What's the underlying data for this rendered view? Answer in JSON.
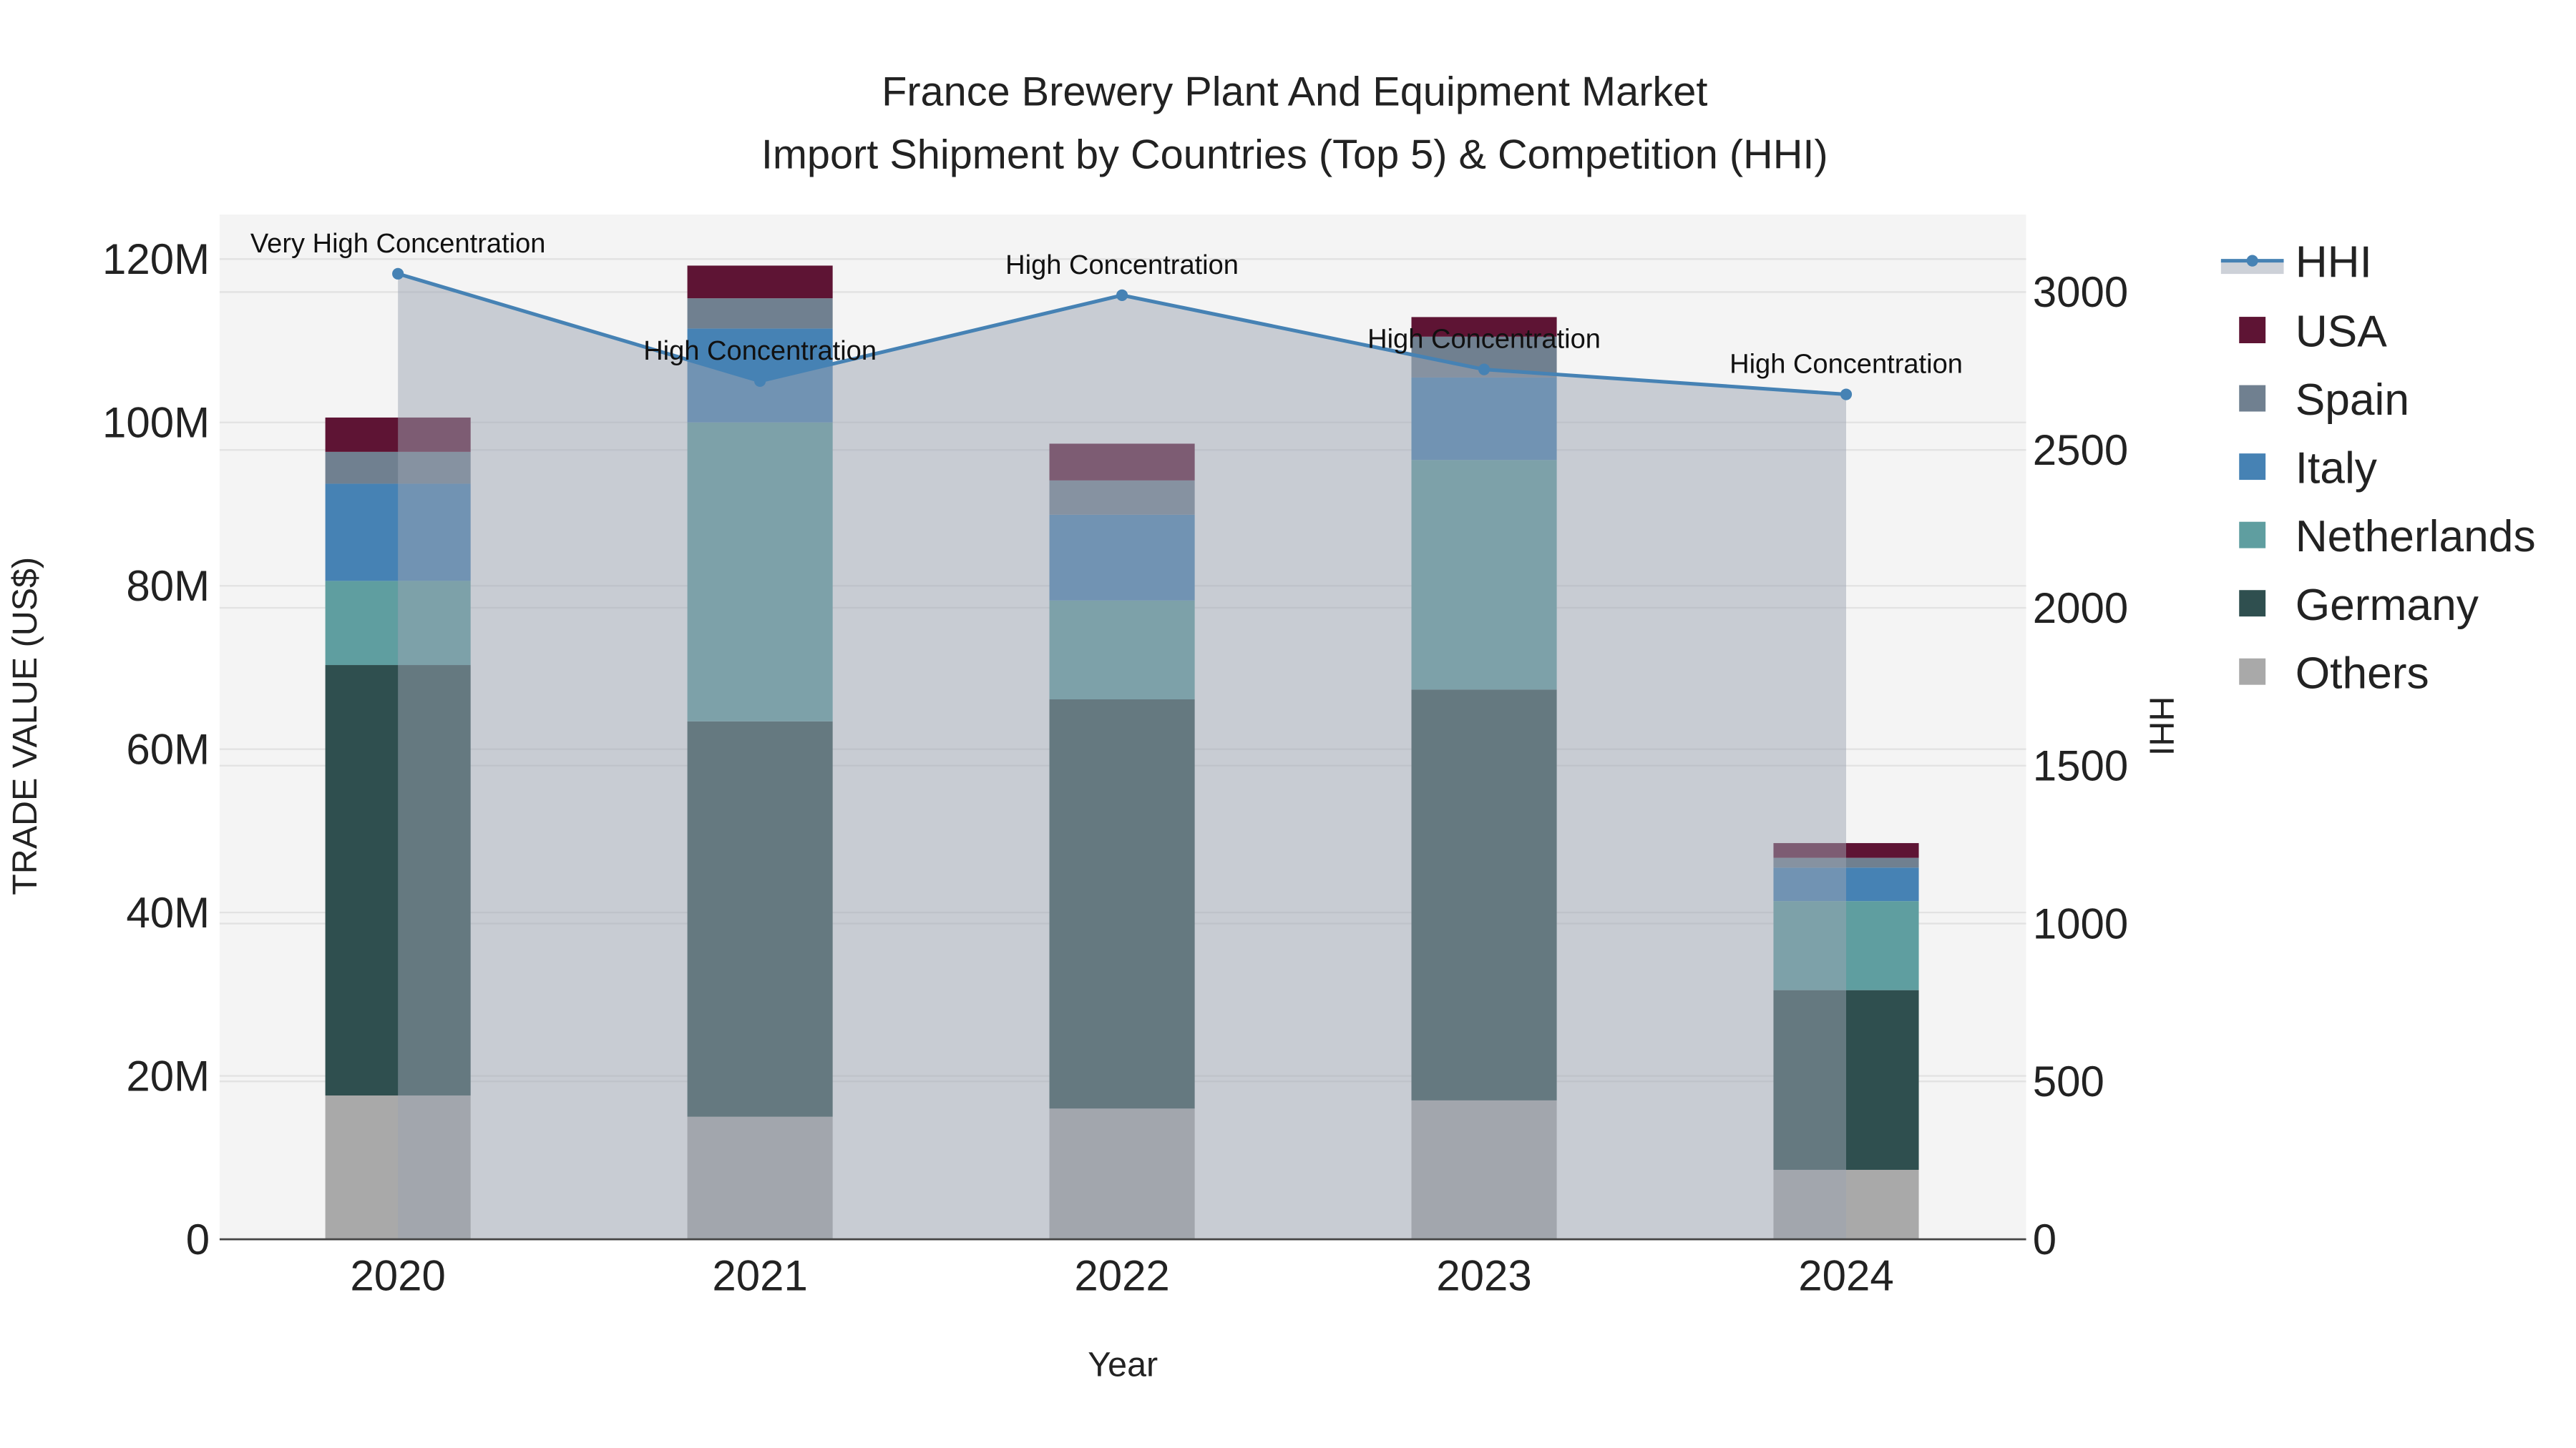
{
  "chart_data": {
    "type": "bar",
    "stacked": true,
    "title": "France Brewery Plant And Equipment Market",
    "subtitle": "Import Shipment by Countries (Top 5) & Competition (HHI)",
    "xlabel": "Year",
    "ylabel": "TRADE VALUE (US$)",
    "y2label": "HHI",
    "categories": [
      "2020",
      "2021",
      "2022",
      "2023",
      "2024"
    ],
    "ylim": [
      0,
      125
    ],
    "y_ticks": [
      0,
      20,
      40,
      60,
      80,
      100,
      120
    ],
    "y_tick_labels": [
      "0",
      "20M",
      "40M",
      "60M",
      "80M",
      "100M",
      "120M"
    ],
    "y2lim": [
      0,
      3240
    ],
    "y2_ticks": [
      0,
      500,
      1000,
      1500,
      2000,
      2500,
      3000
    ],
    "y2_tick_labels": [
      "0",
      "500",
      "1000",
      "1500",
      "2000",
      "2500",
      "3000"
    ],
    "units": "US$ millions",
    "series": [
      {
        "name": "Others",
        "color": "#a9a9a9",
        "values": [
          17.6,
          15.0,
          16.0,
          17.0,
          8.5
        ]
      },
      {
        "name": "Germany",
        "color": "#2f4f4f",
        "values": [
          52.7,
          48.4,
          50.1,
          50.3,
          22.0
        ]
      },
      {
        "name": "Netherlands",
        "color": "#5f9ea0",
        "values": [
          10.3,
          36.6,
          12.1,
          28.1,
          10.9
        ]
      },
      {
        "name": "Italy",
        "color": "#4682b4",
        "values": [
          11.9,
          11.5,
          10.5,
          10.1,
          4.1
        ]
      },
      {
        "name": "Spain",
        "color": "#708090",
        "values": [
          3.9,
          3.7,
          4.2,
          5.0,
          1.2
        ]
      },
      {
        "name": "USA",
        "color": "#5e1434",
        "values": [
          4.2,
          4.0,
          4.5,
          2.4,
          1.8
        ]
      }
    ],
    "hhi": {
      "name": "HHI",
      "color": "#4682b4",
      "values": [
        3058,
        2718,
        2990,
        2755,
        2676
      ],
      "annotations": [
        "Very High Concentration",
        "High Concentration",
        "High Concentration",
        "High Concentration",
        "High Concentration"
      ]
    },
    "legend": {
      "placement": "right",
      "order": [
        "HHI",
        "USA",
        "Spain",
        "Italy",
        "Netherlands",
        "Germany",
        "Others"
      ]
    },
    "grid": true
  }
}
